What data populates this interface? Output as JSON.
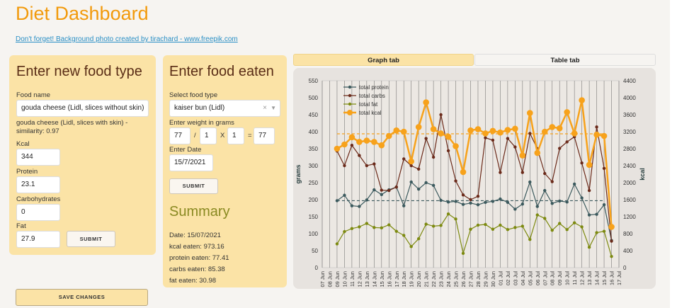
{
  "title": "Diet Dashboard",
  "credit": "Don't forget! Background photo created by tirachard - www.freepik.com",
  "new_food": {
    "heading": "Enter new food type",
    "name_label": "Food name",
    "name_value": "gouda cheese (Lidl, slices without skin)",
    "similar_text": "gouda cheese (Lidl, slices with skin) - similarity: 0.97",
    "kcal_label": "Kcal",
    "kcal_value": "344",
    "protein_label": "Protein",
    "protein_value": "23.1",
    "carbs_label": "Carbohydrates",
    "carbs_value": "0",
    "fat_label": "Fat",
    "fat_value": "27.9",
    "submit": "SUBMIT"
  },
  "food_eaten": {
    "heading": "Enter food eaten",
    "select_label": "Select food type",
    "select_value": "kaiser bun (Lidl)",
    "weight_label": "Enter weight in grams",
    "weight_a": "77",
    "slash": "/",
    "weight_b": "1",
    "times": "X",
    "weight_c": "1",
    "equals": "=",
    "weight_result": "77",
    "date_label": "Enter Date",
    "date_value": "15/7/2021",
    "submit": "SUBMIT"
  },
  "summary": {
    "heading": "Summary",
    "date": "Date: 15/07/2021",
    "kcal": "kcal eaten: 973.16",
    "protein": "protein eaten: 77.41",
    "carbs": "carbs eaten: 85.38",
    "fat": "fat eaten: 30.98"
  },
  "save_button": "SAVE CHANGES",
  "tabs": [
    {
      "label": "Graph tab",
      "active": true
    },
    {
      "label": "Table tab",
      "active": false
    }
  ],
  "colors": {
    "title": "#f29a0c",
    "protein": "#3c5a5e",
    "carbs": "#6b2a1a",
    "fat": "#7d8a10",
    "kcal": "#f7a21b"
  },
  "chart_data": {
    "type": "line",
    "y_left_label": "grams",
    "y_right_label": "kcal",
    "ylim": [
      0,
      550
    ],
    "y2lim": [
      0,
      4400
    ],
    "y_ticks": [
      0,
      50,
      100,
      150,
      200,
      250,
      300,
      350,
      400,
      450,
      500,
      550
    ],
    "y2_ticks": [
      0,
      400,
      800,
      1200,
      1600,
      2000,
      2400,
      2800,
      3200,
      3600,
      4000,
      4400
    ],
    "x": [
      "07 Jun",
      "08 Jun",
      "09 Jun",
      "10 Jun",
      "11 Jun",
      "12 Jun",
      "13 Jun",
      "14 Jun",
      "15 Jun",
      "16 Jun",
      "17 Jun",
      "18 Jun",
      "19 Jun",
      "20 Jun",
      "21 Jun",
      "22 Jun",
      "23 Jun",
      "24 Jun",
      "25 Jun",
      "26 Jun",
      "27 Jun",
      "28 Jun",
      "29 Jun",
      "30 Jun",
      "01 Jul",
      "02 Jul",
      "03 Jul",
      "04 Jul",
      "05 Jul",
      "06 Jul",
      "07 Jul",
      "08 Jul",
      "09 Jul",
      "10 Jul",
      "11 Jul",
      "12 Jul",
      "13 Jul",
      "14 Jul",
      "15 Jul",
      "16 Jul",
      "17 Jul"
    ],
    "series": [
      {
        "name": "total protein",
        "axis": "left",
        "values": [
          null,
          null,
          197,
          213,
          182,
          180,
          199,
          229,
          215,
          229,
          237,
          182,
          252,
          231,
          250,
          242,
          198,
          193,
          195,
          186,
          190,
          185,
          192,
          195,
          202,
          192,
          172,
          187,
          252,
          180,
          227,
          189,
          196,
          193,
          246,
          205,
          155,
          157,
          185,
          80,
          null
        ]
      },
      {
        "name": "total carbs",
        "axis": "left",
        "values": [
          null,
          null,
          343,
          300,
          360,
          330,
          300,
          305,
          228,
          227,
          237,
          320,
          300,
          290,
          380,
          325,
          450,
          344,
          255,
          214,
          200,
          210,
          382,
          375,
          280,
          380,
          355,
          280,
          395,
          350,
          277,
          253,
          351,
          370,
          385,
          308,
          227,
          414,
          292,
          78,
          null
        ]
      },
      {
        "name": "total fat",
        "axis": "left",
        "values": [
          null,
          null,
          70,
          106,
          115,
          120,
          130,
          118,
          117,
          126,
          107,
          95,
          62,
          85,
          128,
          122,
          124,
          158,
          143,
          42,
          113,
          125,
          127,
          113,
          125,
          112,
          118,
          122,
          83,
          155,
          145,
          110,
          130,
          112,
          132,
          120,
          60,
          103,
          107,
          33,
          null
        ]
      },
      {
        "name": "total kcal",
        "axis": "right",
        "values": [
          null,
          null,
          2800,
          2900,
          3070,
          2960,
          2990,
          2960,
          2880,
          3100,
          3230,
          3200,
          2500,
          3310,
          3890,
          3260,
          3160,
          3080,
          2860,
          2250,
          3230,
          3260,
          3160,
          3220,
          3180,
          3240,
          3270,
          2640,
          3640,
          2700,
          3200,
          3310,
          3280,
          3660,
          3160,
          3940,
          2420,
          3130,
          3100,
          960,
          null
        ]
      }
    ],
    "reference_lines": [
      {
        "series": "total protein",
        "value": 197
      },
      {
        "series": "total kcal",
        "value": 3150
      }
    ],
    "legend_position": "top-left",
    "grid": true
  }
}
